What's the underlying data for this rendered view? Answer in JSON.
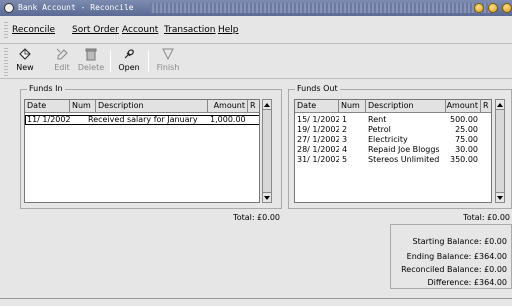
{
  "window": {
    "title": "Bank Account - Reconcile"
  },
  "menu": {
    "reconcile": "Reconcile",
    "sort_order": "Sort Order",
    "account": "Account",
    "transaction": "Transaction",
    "help": "Help"
  },
  "toolbar": {
    "new": "New",
    "edit": "Edit",
    "delete": "Delete",
    "open": "Open",
    "finish": "Finish"
  },
  "funds_in": {
    "label": "Funds In",
    "columns": [
      "Date",
      "Num",
      "Description",
      "Amount",
      "R"
    ],
    "rows": [
      {
        "date": "11/ 1/2002",
        "num": "",
        "description": "Received salary for January",
        "amount": "1,000.00",
        "r": ""
      }
    ],
    "total": "Total: £0.00"
  },
  "funds_out": {
    "label": "Funds Out",
    "columns": [
      "Date",
      "Num",
      "Description",
      "Amount",
      "R"
    ],
    "rows": [
      {
        "date": "15/ 1/2002",
        "num": "1",
        "description": "Rent",
        "amount": "500.00",
        "r": ""
      },
      {
        "date": "19/ 1/2002",
        "num": "2",
        "description": "Petrol",
        "amount": "25.00",
        "r": ""
      },
      {
        "date": "27/ 1/2002",
        "num": "3",
        "description": "Electricity",
        "amount": "75.00",
        "r": ""
      },
      {
        "date": "28/ 1/2002",
        "num": "4",
        "description": "Repaid Joe Bloggs",
        "amount": "30.00",
        "r": ""
      },
      {
        "date": "31/ 1/2002",
        "num": "5",
        "description": "Stereos Unlimited",
        "amount": "350.00",
        "r": ""
      }
    ],
    "total": "Total: £0.00"
  },
  "summary": {
    "starting": "Starting Balance:   £0.00",
    "ending": "Ending Balance: £364.00",
    "reconciled": "Reconciled Balance:   £0.00",
    "difference": "Difference: £364.00"
  }
}
